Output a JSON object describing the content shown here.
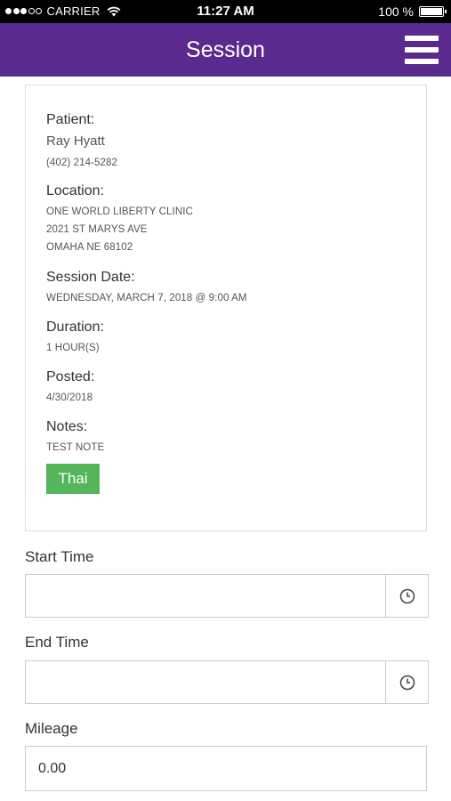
{
  "status_bar": {
    "carrier": "CARRIER",
    "time": "11:27 AM",
    "battery": "100 %",
    "signal_bars_filled": 3,
    "signal_bars_total": 5
  },
  "header": {
    "title": "Session",
    "menu_icon": "hamburger-menu-icon",
    "background_color": "#5b2a8e"
  },
  "session": {
    "patient_label": "Patient:",
    "patient_name": "Ray Hyatt",
    "patient_phone": "(402) 214-5282",
    "location_label": "Location:",
    "location_line1": "ONE WORLD LIBERTY CLINIC",
    "location_line2": "2021 ST MARYS AVE",
    "location_line3": "OMAHA NE 68102",
    "date_label": "Session Date:",
    "date_value": "WEDNESDAY, MARCH 7, 2018 @ 9:00 AM",
    "duration_label": "Duration:",
    "duration_value": "1 HOUR(S)",
    "posted_label": "Posted:",
    "posted_value": "4/30/2018",
    "notes_label": "Notes:",
    "notes_value": "TEST NOTE",
    "language_tag": "Thai",
    "tag_color": "#55b55a"
  },
  "form": {
    "start_time_label": "Start Time",
    "start_time_value": "",
    "start_time_icon": "clock-icon",
    "end_time_label": "End Time",
    "end_time_value": "",
    "end_time_icon": "clock-icon",
    "mileage_label": "Mileage",
    "mileage_value": "0.00"
  }
}
